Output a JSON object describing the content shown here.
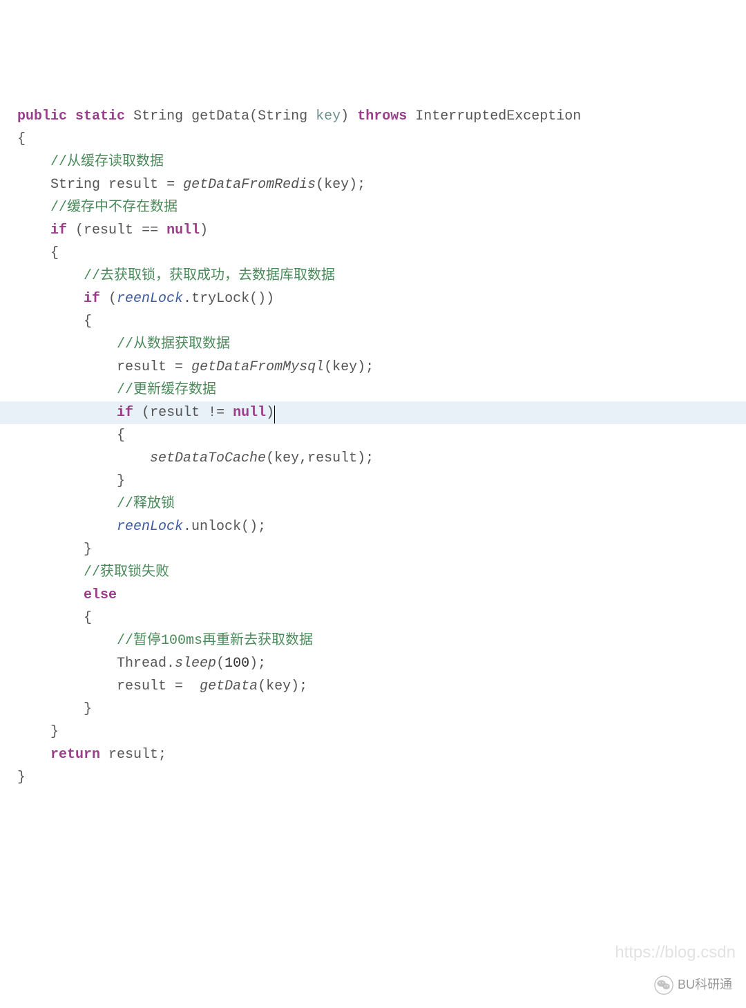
{
  "code": {
    "sig_public": "public",
    "sig_static": "static",
    "sig_type": "String",
    "sig_name": "getData",
    "sig_paramtype": "String",
    "sig_paramname": "key",
    "sig_throws": "throws",
    "sig_exception": "InterruptedException",
    "brace_open": "{",
    "brace_close": "}",
    "c1": "//从缓存读取数据",
    "l1_type": "String",
    "l1_var": "result",
    "l1_eq": " = ",
    "l1_call": "getDataFromRedis",
    "l1_arg": "key",
    "c2": "//缓存中不存在数据",
    "if1": "if",
    "if1_cond_a": "result ",
    "if1_cond_op": "==",
    "if1_cond_b": " null",
    "c3": "//去获取锁，获取成功，去数据库取数据",
    "if2": "if",
    "if2_obj": "reenLock",
    "if2_dot": ".tryLock())",
    "c4": "//从数据获取数据",
    "l2_var": "result = ",
    "l2_call": "getDataFromMysql",
    "l2_arg": "key",
    "c5": "//更新缓存数据",
    "if3": "if",
    "if3_cond_a": "result ",
    "if3_cond_op": "!=",
    "if3_cond_b": " null",
    "l3_call": "setDataToCache",
    "l3_args": "(key,result);",
    "c6": "//释放锁",
    "l4_obj": "reenLock",
    "l4_call": ".unlock();",
    "c7": "//获取锁失败",
    "else": "else",
    "c8": "//暂停100ms再重新去获取数据",
    "l5_a": "Thread.",
    "l5_call": "sleep",
    "l5_arg": "100",
    "l6_a": "result =  ",
    "l6_call": "getData",
    "l6_arg": "key",
    "ret": "return",
    "ret_val": " result;"
  },
  "watermark": {
    "url": "https://blog.csdn",
    "badge": "BU科研通"
  }
}
